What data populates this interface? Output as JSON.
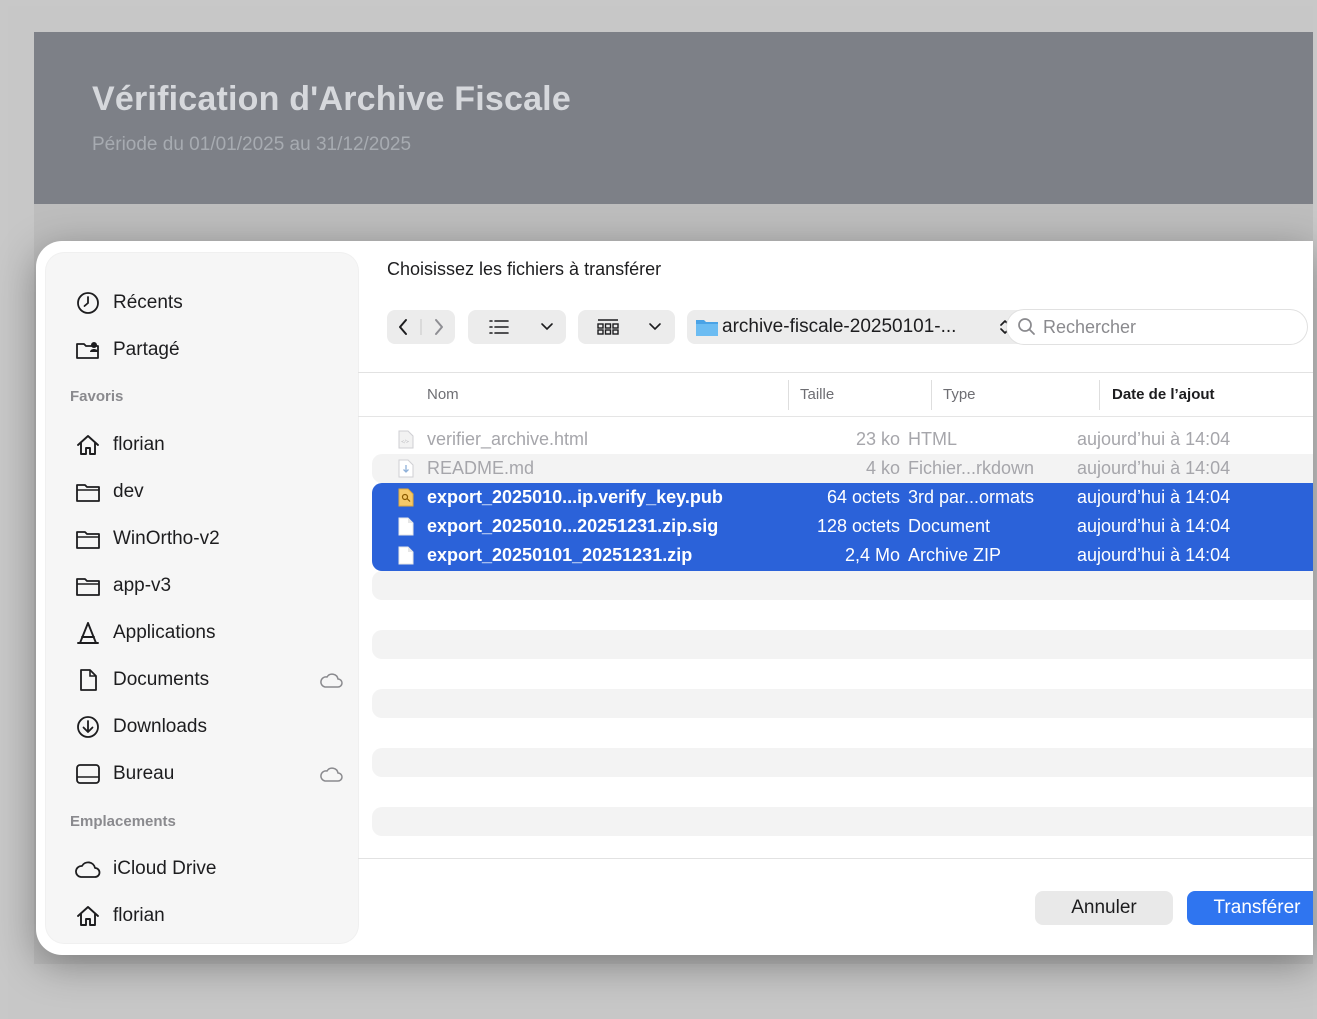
{
  "app": {
    "title": "Vérification d'Archive Fiscale",
    "subtitle": "Période du 01/01/2025 au 31/12/2025"
  },
  "dialog": {
    "prompt": "Choisissez les fichiers à transférer",
    "path_label": "archive-fiscale-20250101-...",
    "search_placeholder": "Rechercher",
    "cancel_label": "Annuler",
    "ok_label": "Transférer"
  },
  "sidebar": {
    "top_items": [
      {
        "label": "Récents",
        "icon": "clock-icon"
      },
      {
        "label": "Partagé",
        "icon": "shared-folder-icon"
      }
    ],
    "favorites_title": "Favoris",
    "favorites": [
      {
        "label": "florian",
        "icon": "home-icon",
        "cloud": false
      },
      {
        "label": "dev",
        "icon": "folder-icon",
        "cloud": false
      },
      {
        "label": "WinOrtho-v2",
        "icon": "folder-icon",
        "cloud": false
      },
      {
        "label": "app-v3",
        "icon": "folder-icon",
        "cloud": false
      },
      {
        "label": "Applications",
        "icon": "applications-icon",
        "cloud": false
      },
      {
        "label": "Documents",
        "icon": "document-icon",
        "cloud": true
      },
      {
        "label": "Downloads",
        "icon": "download-icon",
        "cloud": true
      },
      {
        "label": "Bureau",
        "icon": "desktop-icon",
        "cloud": true
      }
    ],
    "locations_title": "Emplacements",
    "locations": [
      {
        "label": "iCloud Drive",
        "icon": "cloud-icon"
      },
      {
        "label": "florian",
        "icon": "home-icon"
      }
    ]
  },
  "columns": {
    "name": "Nom",
    "size": "Taille",
    "type": "Type",
    "date": "Date de l’ajout"
  },
  "files": [
    {
      "name": "verifier_archive.html",
      "size": "23 ko",
      "type": "HTML",
      "date": "aujourd’hui à 14:04",
      "state": "disabled",
      "icon": "html-file-icon"
    },
    {
      "name": "README.md",
      "size": "4 ko",
      "type": "Fichier...rkdown",
      "date": "aujourd’hui à 14:04",
      "state": "disabled",
      "icon": "markdown-file-icon"
    },
    {
      "name": "export_2025010...ip.verify_key.pub",
      "size": "64 octets",
      "type": "3rd par...ormats",
      "date": "aujourd’hui à 14:04",
      "state": "selected",
      "icon": "key-file-icon"
    },
    {
      "name": "export_2025010...20251231.zip.sig",
      "size": "128 octets",
      "type": "Document",
      "date": "aujourd’hui à 14:04",
      "state": "selected",
      "icon": "document-file-icon"
    },
    {
      "name": "export_20250101_20251231.zip",
      "size": "2,4 Mo",
      "type": "Archive ZIP",
      "date": "aujourd’hui à 14:04",
      "state": "selected",
      "icon": "zip-file-icon"
    }
  ],
  "colors": {
    "selection": "#2b62d9",
    "primary_button": "#2f75f0",
    "header_bg": "#7d8087"
  }
}
